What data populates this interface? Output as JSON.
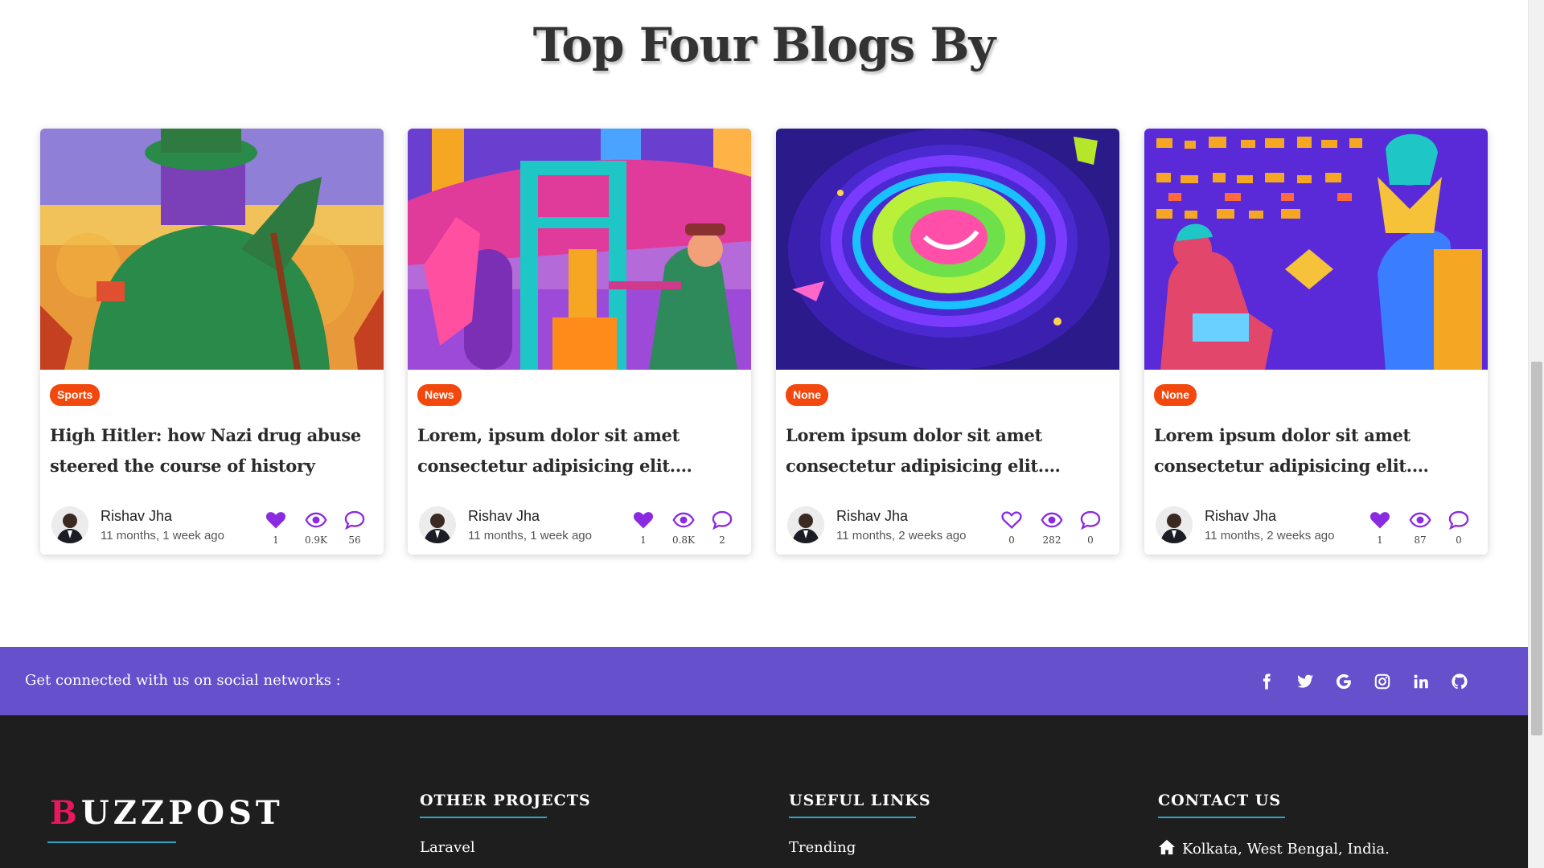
{
  "section": {
    "title": "Top Four Blogs By"
  },
  "cards": [
    {
      "category": "Sports",
      "title": "High Hitler: how Nazi drug abuse steered the course of history",
      "author": "Rishav Jha",
      "time": "11 months, 1 week ago",
      "likes": "1",
      "views": "0.9K",
      "comments": "56",
      "liked": true
    },
    {
      "category": "News",
      "title": "Lorem, ipsum dolor sit amet consectetur adipisicing elit. Pariatur dolore sint",
      "author": "Rishav Jha",
      "time": "11 months, 1 week ago",
      "likes": "1",
      "views": "0.8K",
      "comments": "2",
      "liked": true
    },
    {
      "category": "None",
      "title": "Lorem ipsum dolor sit amet consectetur adipisicing elit. Corporis, voluptatem",
      "author": "Rishav Jha",
      "time": "11 months, 2 weeks ago",
      "likes": "0",
      "views": "282",
      "comments": "0",
      "liked": false
    },
    {
      "category": "None",
      "title": "Lorem ipsum dolor sit amet consectetur adipisicing elit. Corporis, voluptatem",
      "author": "Rishav Jha",
      "time": "11 months, 2 weeks ago",
      "likes": "1",
      "views": "87",
      "comments": "0",
      "liked": true
    }
  ],
  "social": {
    "text": "Get connected with us on social networks :",
    "icons": [
      "facebook-icon",
      "twitter-icon",
      "google-icon",
      "instagram-icon",
      "linkedin-icon",
      "github-icon"
    ]
  },
  "footer": {
    "brand_first": "B",
    "brand_rest": "UZZPOST",
    "other_projects": {
      "title": "OTHER PROJECTS",
      "items": [
        "Laravel"
      ]
    },
    "useful_links": {
      "title": "USEFUL LINKS",
      "items": [
        "Trending"
      ]
    },
    "contact": {
      "title": "CONTACT US",
      "items": [
        "Kolkata, West Bengal, India."
      ]
    }
  },
  "colors": {
    "accent": "#8a2be2",
    "badge": "#f2480d",
    "social_bar": "#6650cc",
    "footer": "#1e1e1e",
    "underline": "#2aa6c9",
    "brand_first": "#e8185e"
  }
}
